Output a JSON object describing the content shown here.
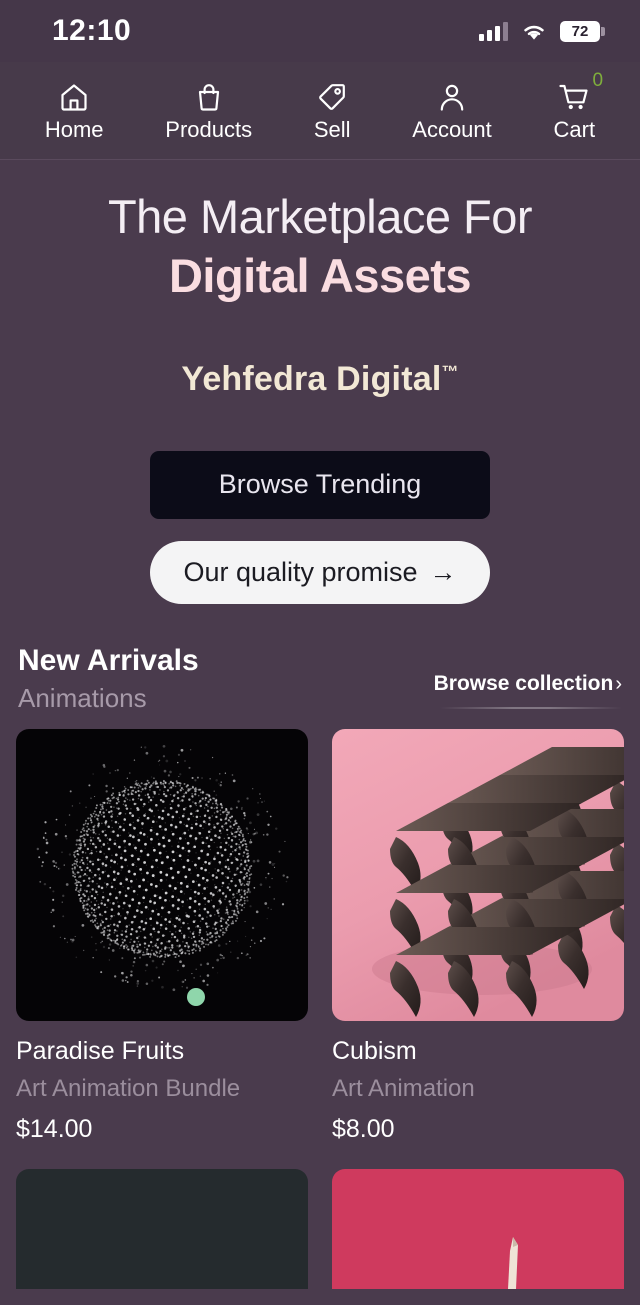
{
  "status_bar": {
    "time": "12:10",
    "signal_icon": "cellular-signal-icon",
    "wifi_icon": "wifi-icon",
    "battery_level": "72",
    "battery_icon": "battery-icon"
  },
  "nav": {
    "items": [
      {
        "label": "Home",
        "icon": "home-icon"
      },
      {
        "label": "Products",
        "icon": "shopping-bag-icon"
      },
      {
        "label": "Sell",
        "icon": "price-tag-icon"
      },
      {
        "label": "Account",
        "icon": "user-icon"
      },
      {
        "label": "Cart",
        "icon": "shopping-cart-icon",
        "badge": "0"
      }
    ]
  },
  "hero": {
    "title_line1": "The Marketplace For",
    "title_line2": "Digital Assets",
    "brand": "Yehfedra Digital",
    "brand_tm": "™",
    "primary_cta": "Browse Trending",
    "secondary_cta": "Our quality promise",
    "secondary_cta_arrow": "→"
  },
  "section": {
    "title": "New Arrivals",
    "subtitle": "Animations",
    "browse_label": "Browse collection",
    "browse_chevron": "›"
  },
  "products": [
    {
      "title": "Paradise Fruits",
      "subtitle": "Art Animation Bundle",
      "price": "$14.00",
      "thumb": "particle-sphere-animation-thumbnail"
    },
    {
      "title": "Cubism",
      "subtitle": "Art Animation",
      "price": "$8.00",
      "thumb": "dark-lattice-sculpture-thumbnail"
    },
    {
      "title": "",
      "subtitle": "",
      "price": "",
      "thumb": "dark-slate-thumbnail"
    },
    {
      "title": "",
      "subtitle": "",
      "price": "",
      "thumb": "crimson-shape-thumbnail"
    }
  ],
  "colors": {
    "background": "#4a3b4d",
    "navbar": "#473a4a",
    "statusbar": "#453749",
    "hero_accent": "#fadde1",
    "brand_accent": "#f2e8d5",
    "primary_button": "#0c0c18",
    "secondary_button": "#f4f4f5",
    "cart_badge": "#7fae3c",
    "muted_text": "#9b8e9d",
    "card3_bg": "#252b2e",
    "card4_bg": "#cf3a5e"
  }
}
